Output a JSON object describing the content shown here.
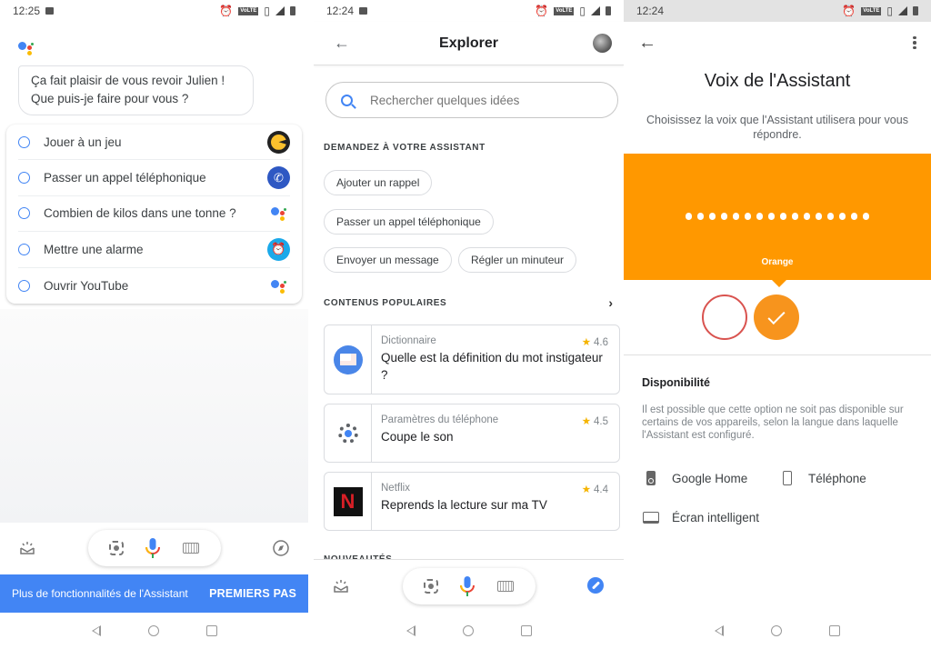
{
  "panel1": {
    "status": {
      "time": "12:25",
      "volte": "VoLTE"
    },
    "greeting": "Ça fait plaisir de vous revoir Julien ! Que puis-je faire pour vous ?",
    "suggestions": [
      {
        "label": "Jouer à un jeu",
        "icon": "game-icon"
      },
      {
        "label": "Passer un appel téléphonique",
        "icon": "phone-icon"
      },
      {
        "label": "Combien de kilos dans une tonne ?",
        "icon": "google-assistant-icon"
      },
      {
        "label": "Mettre une alarme",
        "icon": "alarm-icon"
      },
      {
        "label": "Ouvrir YouTube",
        "icon": "google-assistant-icon"
      }
    ],
    "promo": {
      "text": "Plus de fonctionnalités de l'Assistant",
      "button": "PREMIERS PAS",
      "color": "#4285f4"
    }
  },
  "panel2": {
    "status": {
      "time": "12:24",
      "volte": "VoLTE"
    },
    "title": "Explorer",
    "search_placeholder": "Rechercher quelques idées",
    "ask_section": "DEMANDEZ À VOTRE ASSISTANT",
    "chips": [
      "Ajouter un rappel",
      "Passer un appel téléphonique",
      "Envoyer un message",
      "Régler un minuteur"
    ],
    "popular_section": "CONTENUS POPULAIRES",
    "popular": [
      {
        "provider": "Dictionnaire",
        "rating": "4.6",
        "query": "Quelle est la définition du mot instigateur ?",
        "icon": "dictionary-icon"
      },
      {
        "provider": "Paramètres du téléphone",
        "rating": "4.5",
        "query": "Coupe le son",
        "icon": "settings-gear-icon"
      },
      {
        "provider": "Netflix",
        "rating": "4.4",
        "query": "Reprends la lecture sur ma TV",
        "icon": "netflix-icon",
        "icon_text": "N"
      }
    ],
    "new_section": "NOUVEAUTÉS"
  },
  "panel3": {
    "status": {
      "time": "12:24",
      "volte": "VoLTE"
    },
    "title": "Voix de l'Assistant",
    "subtitle": "Choisissez la voix que l'Assistant utilisera pour vous répondre.",
    "selected_voice": "Orange",
    "voice_color": "#ff9800",
    "voices": [
      {
        "name": "Rouge",
        "color": "#d9534f",
        "selected": false
      },
      {
        "name": "Orange",
        "color": "#f7941d",
        "selected": true
      }
    ],
    "availability_title": "Disponibilité",
    "availability_text": "Il est possible que cette option ne soit pas disponible sur certains de vos appareils, selon la langue dans laquelle l'Assistant est configuré.",
    "devices": [
      "Google Home",
      "Téléphone",
      "Écran intelligent"
    ]
  }
}
